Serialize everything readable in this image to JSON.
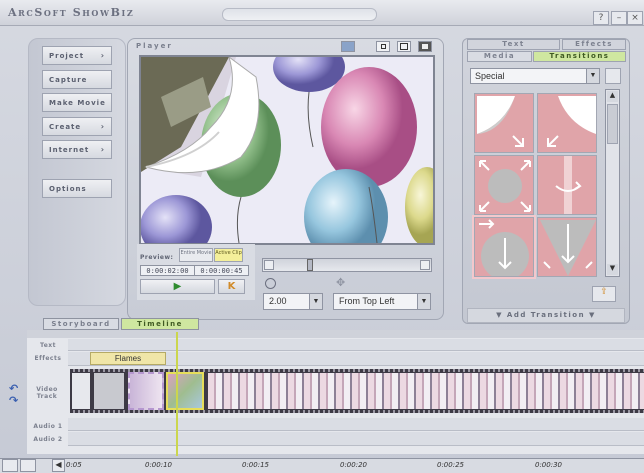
{
  "app": {
    "title": "ArcSoft ShowBiz",
    "window_buttons": [
      "?",
      "–",
      "×"
    ]
  },
  "nav": {
    "items": [
      {
        "label": "Project",
        "arrow": "›"
      },
      {
        "label": "Capture",
        "arrow": ""
      },
      {
        "label": "Make Movie",
        "arrow": ""
      },
      {
        "label": "Create",
        "arrow": "›"
      },
      {
        "label": "Internet",
        "arrow": "›"
      }
    ],
    "options": "Options"
  },
  "player": {
    "label": "Player",
    "preview_label": "Preview:",
    "entire_movie": "Entire Movie",
    "active_clip": "Active Clip",
    "time_start": "0:00:02:00",
    "time_end": "0:00:00:45",
    "play_icon": "▶",
    "mark_icon": "K",
    "duration_value": "2.00",
    "direction_value": "From Top Left"
  },
  "right_panel": {
    "tabs": [
      "Text",
      "Effects",
      "Media",
      "Transitions"
    ],
    "selected_tab": "Transitions",
    "category": "Special",
    "add_transition": "Add Transition"
  },
  "timeline": {
    "tabs": [
      "Storyboard",
      "Timeline"
    ],
    "active_tab": "Timeline",
    "rows": [
      "Text",
      "Effects",
      "Video Track",
      "Audio 1",
      "Audio 2"
    ],
    "effect_clip": "Flames",
    "undo_icon": "↶",
    "redo_icon": "↷",
    "ruler": [
      "0:05",
      "0:00:10",
      "0:00:15",
      "0:00:20",
      "0:00:25",
      "0:00:30"
    ]
  },
  "colors": {
    "accent_green": "#cfe7a0",
    "transition_pink": "#e0a4a9",
    "active_yellow": "#f4ef9a",
    "playhead": "#cbd64e"
  }
}
